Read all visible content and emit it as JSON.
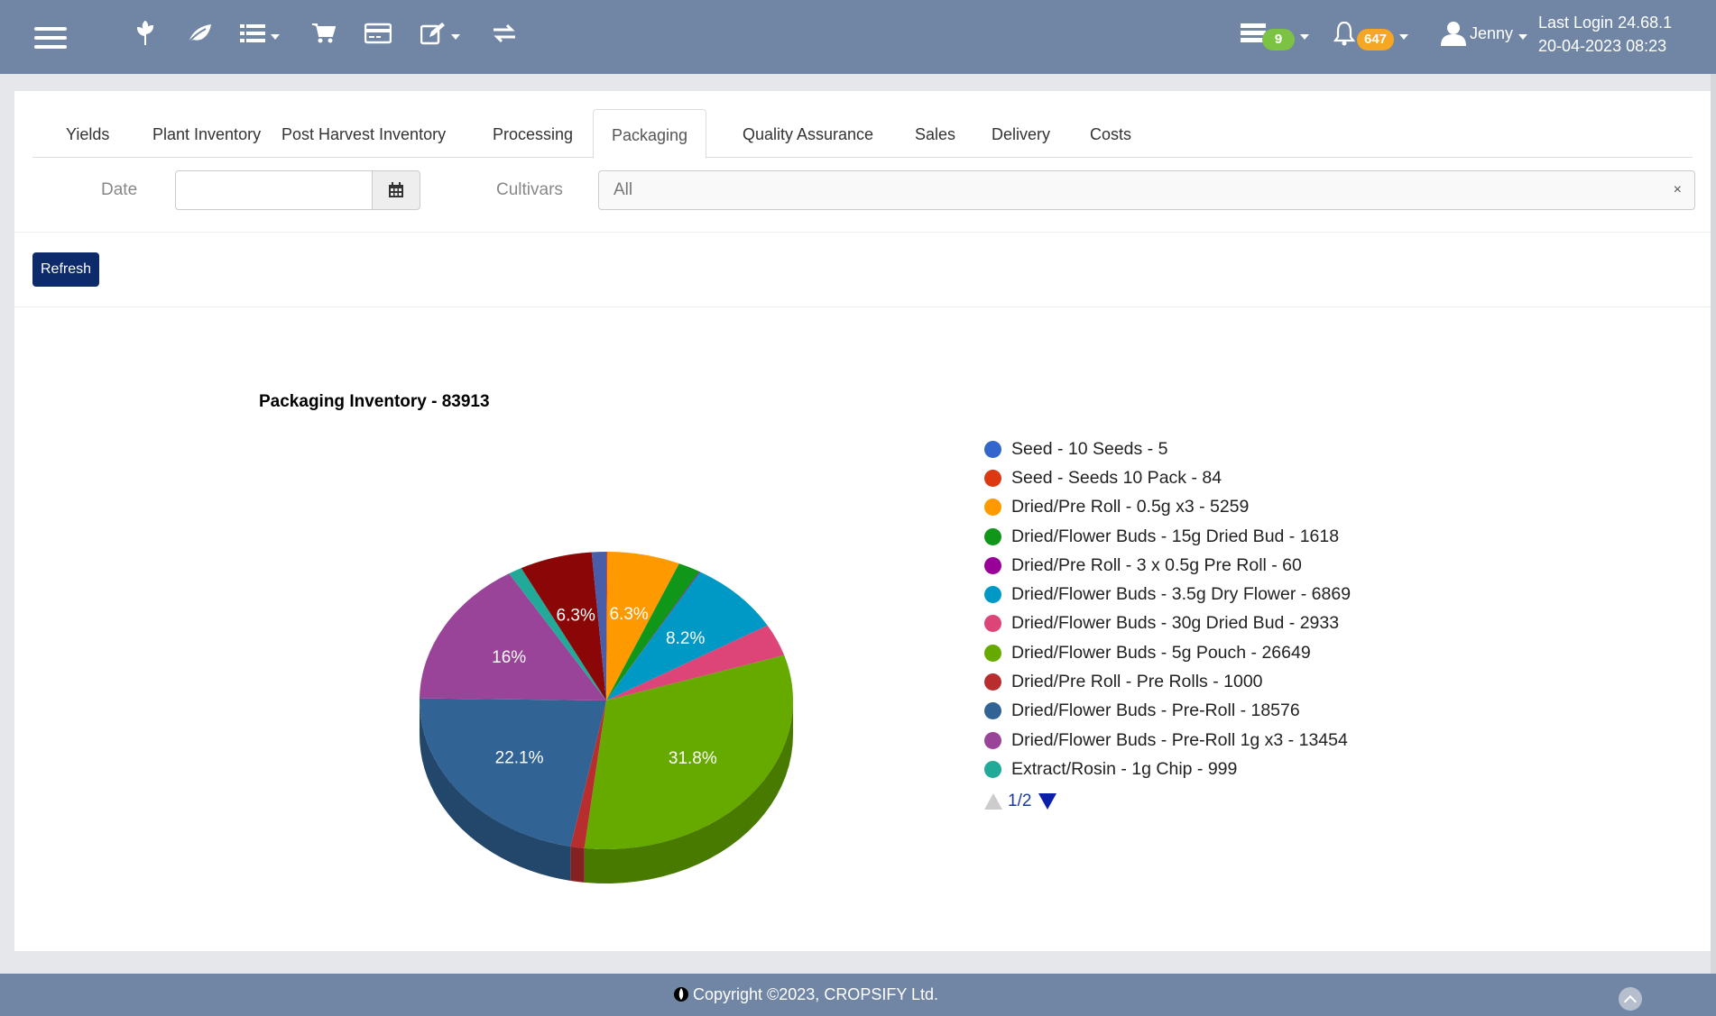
{
  "header": {
    "menu_icon": "hamburger-icon",
    "nav_icons": [
      "plant-icon",
      "leaf-icon",
      "list-icon",
      "cart-icon",
      "credit-card-icon",
      "edit-icon",
      "transfer-icon"
    ],
    "tasks_badge": "9",
    "notifications_badge": "647",
    "user": "Jenny",
    "last_login_label": "Last Login 24.68.1",
    "last_login_time": "20-04-2023 08:23"
  },
  "tabs": [
    {
      "label": "Yields"
    },
    {
      "label": "Plant Inventory"
    },
    {
      "label": "Post Harvest Inventory"
    },
    {
      "label": "Processing"
    },
    {
      "label": "Packaging",
      "active": true
    },
    {
      "label": "Quality Assurance"
    },
    {
      "label": "Sales"
    },
    {
      "label": "Delivery"
    },
    {
      "label": "Costs"
    }
  ],
  "filters": {
    "date_label": "Date",
    "date_value": "",
    "cultivars_label": "Cultivars",
    "cultivars_value": "All",
    "clear": "×"
  },
  "refresh_label": "Refresh",
  "chart_data": {
    "type": "pie",
    "title": "Packaging Inventory - 83913",
    "slices": [
      {
        "label": "Seed - 10 Seeds - 5",
        "value": 5,
        "color": "#3366cc"
      },
      {
        "label": "Seed - Seeds 10 Pack - 84",
        "value": 84,
        "color": "#dc3912"
      },
      {
        "label": "Dried/Pre Roll - 0.5g x3 - 5259",
        "value": 5259,
        "color": "#ff9900"
      },
      {
        "label": "Dried/Flower Buds - 15g Dried Bud - 1618",
        "value": 1618,
        "color": "#109618"
      },
      {
        "label": "Dried/Pre Roll - 3 x 0.5g Pre Roll - 60",
        "value": 60,
        "color": "#990099"
      },
      {
        "label": "Dried/Flower Buds - 3.5g Dry Flower - 6869",
        "value": 6869,
        "color": "#0099c6"
      },
      {
        "label": "Dried/Flower Buds - 30g Dried Bud - 2933",
        "value": 2933,
        "color": "#dd4477"
      },
      {
        "label": "Dried/Flower Buds - 5g Pouch - 26649",
        "value": 26649,
        "color": "#66aa00"
      },
      {
        "label": "Dried/Pre Roll - Pre Rolls - 1000",
        "value": 1000,
        "color": "#b82e2e"
      },
      {
        "label": "Dried/Flower Buds - Pre-Roll - 18576",
        "value": 18576,
        "color": "#316395"
      },
      {
        "label": "Dried/Flower Buds - Pre-Roll 1g x3 - 13454",
        "value": 13454,
        "color": "#994499"
      },
      {
        "label": "Extract/Rosin - 1g Chip - 999",
        "value": 999,
        "color": "#22aa99"
      },
      {
        "value": 5260,
        "color": "#8b0707"
      },
      {
        "value": 1047,
        "color": "#4a5da8"
      }
    ],
    "slice_labels": [
      {
        "slice": 2,
        "text": "6.3%"
      },
      {
        "slice": 5,
        "text": "8.2%"
      },
      {
        "slice": 7,
        "text": "31.8%"
      },
      {
        "slice": 9,
        "text": "22.1%"
      },
      {
        "slice": 10,
        "text": "16%"
      },
      {
        "slice": 12,
        "text": "6.3%"
      }
    ],
    "legend_page": "1/2",
    "legend_placement": "right"
  },
  "footer": {
    "copyright": "Copyright ©2023, CROPSIFY Ltd."
  }
}
